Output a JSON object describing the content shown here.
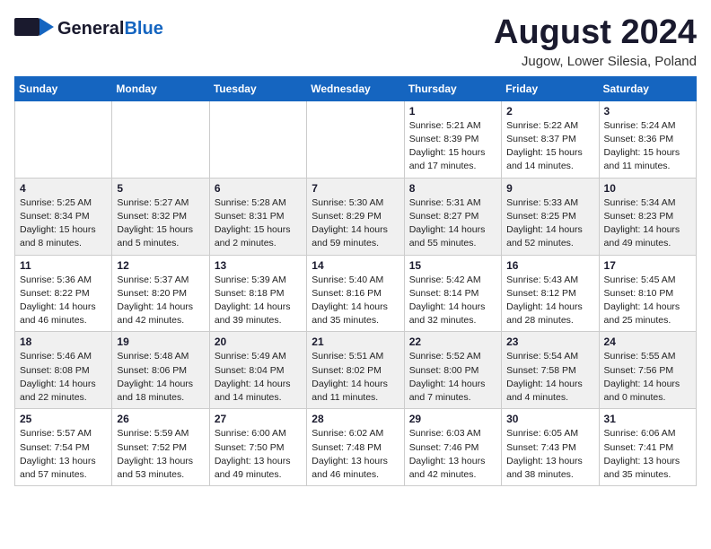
{
  "header": {
    "logo": {
      "general": "General",
      "blue": "Blue"
    },
    "title": "August 2024",
    "location": "Jugow, Lower Silesia, Poland"
  },
  "calendar": {
    "days_of_week": [
      "Sunday",
      "Monday",
      "Tuesday",
      "Wednesday",
      "Thursday",
      "Friday",
      "Saturday"
    ],
    "weeks": [
      [
        {
          "day": "",
          "info": ""
        },
        {
          "day": "",
          "info": ""
        },
        {
          "day": "",
          "info": ""
        },
        {
          "day": "",
          "info": ""
        },
        {
          "day": "1",
          "info": "Sunrise: 5:21 AM\nSunset: 8:39 PM\nDaylight: 15 hours\nand 17 minutes."
        },
        {
          "day": "2",
          "info": "Sunrise: 5:22 AM\nSunset: 8:37 PM\nDaylight: 15 hours\nand 14 minutes."
        },
        {
          "day": "3",
          "info": "Sunrise: 5:24 AM\nSunset: 8:36 PM\nDaylight: 15 hours\nand 11 minutes."
        }
      ],
      [
        {
          "day": "4",
          "info": "Sunrise: 5:25 AM\nSunset: 8:34 PM\nDaylight: 15 hours\nand 8 minutes."
        },
        {
          "day": "5",
          "info": "Sunrise: 5:27 AM\nSunset: 8:32 PM\nDaylight: 15 hours\nand 5 minutes."
        },
        {
          "day": "6",
          "info": "Sunrise: 5:28 AM\nSunset: 8:31 PM\nDaylight: 15 hours\nand 2 minutes."
        },
        {
          "day": "7",
          "info": "Sunrise: 5:30 AM\nSunset: 8:29 PM\nDaylight: 14 hours\nand 59 minutes."
        },
        {
          "day": "8",
          "info": "Sunrise: 5:31 AM\nSunset: 8:27 PM\nDaylight: 14 hours\nand 55 minutes."
        },
        {
          "day": "9",
          "info": "Sunrise: 5:33 AM\nSunset: 8:25 PM\nDaylight: 14 hours\nand 52 minutes."
        },
        {
          "day": "10",
          "info": "Sunrise: 5:34 AM\nSunset: 8:23 PM\nDaylight: 14 hours\nand 49 minutes."
        }
      ],
      [
        {
          "day": "11",
          "info": "Sunrise: 5:36 AM\nSunset: 8:22 PM\nDaylight: 14 hours\nand 46 minutes."
        },
        {
          "day": "12",
          "info": "Sunrise: 5:37 AM\nSunset: 8:20 PM\nDaylight: 14 hours\nand 42 minutes."
        },
        {
          "day": "13",
          "info": "Sunrise: 5:39 AM\nSunset: 8:18 PM\nDaylight: 14 hours\nand 39 minutes."
        },
        {
          "day": "14",
          "info": "Sunrise: 5:40 AM\nSunset: 8:16 PM\nDaylight: 14 hours\nand 35 minutes."
        },
        {
          "day": "15",
          "info": "Sunrise: 5:42 AM\nSunset: 8:14 PM\nDaylight: 14 hours\nand 32 minutes."
        },
        {
          "day": "16",
          "info": "Sunrise: 5:43 AM\nSunset: 8:12 PM\nDaylight: 14 hours\nand 28 minutes."
        },
        {
          "day": "17",
          "info": "Sunrise: 5:45 AM\nSunset: 8:10 PM\nDaylight: 14 hours\nand 25 minutes."
        }
      ],
      [
        {
          "day": "18",
          "info": "Sunrise: 5:46 AM\nSunset: 8:08 PM\nDaylight: 14 hours\nand 22 minutes."
        },
        {
          "day": "19",
          "info": "Sunrise: 5:48 AM\nSunset: 8:06 PM\nDaylight: 14 hours\nand 18 minutes."
        },
        {
          "day": "20",
          "info": "Sunrise: 5:49 AM\nSunset: 8:04 PM\nDaylight: 14 hours\nand 14 minutes."
        },
        {
          "day": "21",
          "info": "Sunrise: 5:51 AM\nSunset: 8:02 PM\nDaylight: 14 hours\nand 11 minutes."
        },
        {
          "day": "22",
          "info": "Sunrise: 5:52 AM\nSunset: 8:00 PM\nDaylight: 14 hours\nand 7 minutes."
        },
        {
          "day": "23",
          "info": "Sunrise: 5:54 AM\nSunset: 7:58 PM\nDaylight: 14 hours\nand 4 minutes."
        },
        {
          "day": "24",
          "info": "Sunrise: 5:55 AM\nSunset: 7:56 PM\nDaylight: 14 hours\nand 0 minutes."
        }
      ],
      [
        {
          "day": "25",
          "info": "Sunrise: 5:57 AM\nSunset: 7:54 PM\nDaylight: 13 hours\nand 57 minutes."
        },
        {
          "day": "26",
          "info": "Sunrise: 5:59 AM\nSunset: 7:52 PM\nDaylight: 13 hours\nand 53 minutes."
        },
        {
          "day": "27",
          "info": "Sunrise: 6:00 AM\nSunset: 7:50 PM\nDaylight: 13 hours\nand 49 minutes."
        },
        {
          "day": "28",
          "info": "Sunrise: 6:02 AM\nSunset: 7:48 PM\nDaylight: 13 hours\nand 46 minutes."
        },
        {
          "day": "29",
          "info": "Sunrise: 6:03 AM\nSunset: 7:46 PM\nDaylight: 13 hours\nand 42 minutes."
        },
        {
          "day": "30",
          "info": "Sunrise: 6:05 AM\nSunset: 7:43 PM\nDaylight: 13 hours\nand 38 minutes."
        },
        {
          "day": "31",
          "info": "Sunrise: 6:06 AM\nSunset: 7:41 PM\nDaylight: 13 hours\nand 35 minutes."
        }
      ]
    ]
  }
}
